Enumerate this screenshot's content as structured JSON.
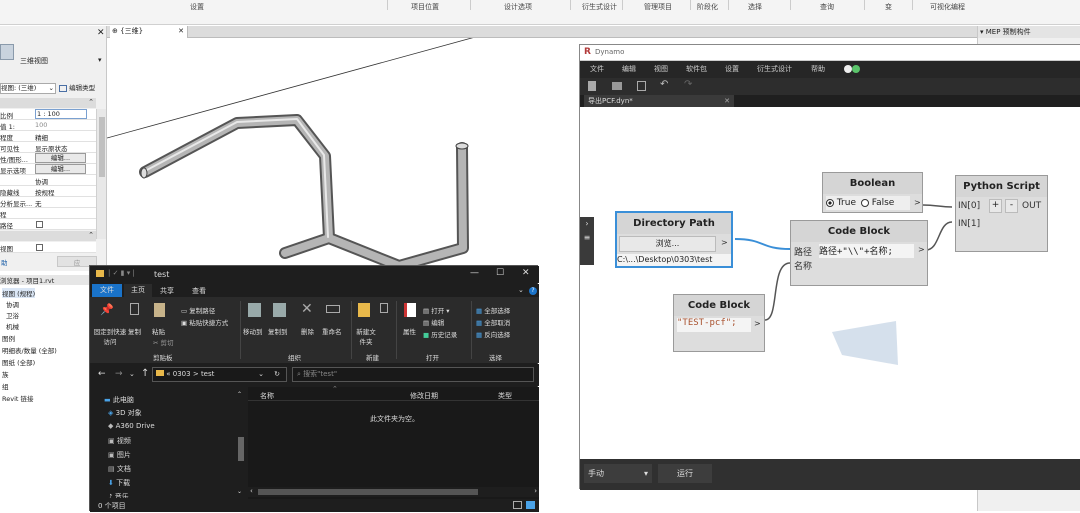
{
  "ribbon": {
    "tabs": [
      "设置",
      "项目位置",
      "设计选项",
      "衍生式设计",
      "管理项目",
      "阶段化",
      "选择",
      "查询",
      "变",
      "可视化编程"
    ]
  },
  "properties": {
    "view_type": "三维视图",
    "view_select": "视图: (三维)",
    "edit_type": "编辑类型",
    "rows": [
      {
        "key": "比例",
        "value": "1 : 100"
      },
      {
        "key": "值 1:",
        "value": "100"
      },
      {
        "key": "程度",
        "value": "精细"
      },
      {
        "key": "可见性",
        "value": "显示原状态"
      },
      {
        "key": "性/图形...",
        "value": "编辑..."
      },
      {
        "key": "显示选项",
        "value": "编辑..."
      },
      {
        "key": "",
        "value": "协调"
      },
      {
        "key": "隐藏线",
        "value": "按规程"
      },
      {
        "key": "分析显示...",
        "value": "无"
      },
      {
        "key": "程",
        "value": ""
      },
      {
        "key": "路径",
        "value": ""
      }
    ],
    "footer_left": "助",
    "footer_right": "应"
  },
  "browser": {
    "title": "浏览器 - 项目1.rvt",
    "items": [
      "视图 (规程)",
      "协调",
      "卫浴",
      "机械",
      "图例",
      "明细表/数量 (全部)",
      "图纸 (全部)",
      "族",
      "组",
      "Revit 链接"
    ]
  },
  "view_tab": {
    "label": "{三维}"
  },
  "right_panel": {
    "title": "MEP 预制构件"
  },
  "dynamo": {
    "title": "Dynamo",
    "menu": [
      "文件",
      "编辑",
      "视图",
      "软件包",
      "设置",
      "衍生式设计",
      "帮助"
    ],
    "file_tab": "导出PCF.dyn*",
    "nodes": {
      "directory_path": {
        "title": "Directory Path",
        "button": "浏览...",
        "value": "C:\\...\\Desktop\\0303\\test"
      },
      "boolean": {
        "title": "Boolean",
        "true_label": "True",
        "false_label": "False"
      },
      "python_script": {
        "title": "Python Script",
        "in0": "IN[0]",
        "in1": "IN[1]",
        "plus": "+",
        "minus": "-",
        "out": "OUT"
      },
      "code_block_main": {
        "title": "Code Block",
        "port1": "路径",
        "port2": "名称",
        "code": "路径+\"\\\\\"+名称;"
      },
      "code_block_name": {
        "title": "Code Block",
        "code": "\"TEST-pcf\";"
      }
    },
    "run_mode": "手动",
    "run_button": "运行"
  },
  "explorer": {
    "title": "test",
    "ribbon_tabs": [
      "文件",
      "主页",
      "共享",
      "查看"
    ],
    "groups": {
      "clipboard": {
        "label": "剪贴板",
        "pin": "固定到快速访问",
        "copy": "复制",
        "paste": "粘贴",
        "copy_path": "复制路径",
        "paste_shortcut": "粘贴快捷方式",
        "cut": "剪切"
      },
      "organize": {
        "label": "组织",
        "move_to": "移动到",
        "copy_to": "复制到",
        "delete": "删除",
        "rename": "重命名"
      },
      "new": {
        "label": "新建",
        "new_folder": "新建文件夹"
      },
      "open": {
        "label": "打开",
        "properties": "属性",
        "open": "打开",
        "edit": "编辑",
        "history": "历史记录"
      },
      "select": {
        "label": "选择",
        "select_all": "全部选择",
        "select_none": "全部取消",
        "invert": "反向选择"
      }
    },
    "address": [
      "«",
      "0303",
      ">",
      "test"
    ],
    "search_placeholder": "搜索\"test\"",
    "columns": [
      "名称",
      "修改日期",
      "类型"
    ],
    "empty_text": "此文件夹为空。",
    "nav_items": [
      "此电脑",
      "3D 对象",
      "A360 Drive",
      "视频",
      "图片",
      "文档",
      "下载",
      "音乐"
    ],
    "status": "0 个项目"
  },
  "colors": {
    "dynamo_wire": "#3a8fd8",
    "explorer_accent": "#1a73c9"
  }
}
